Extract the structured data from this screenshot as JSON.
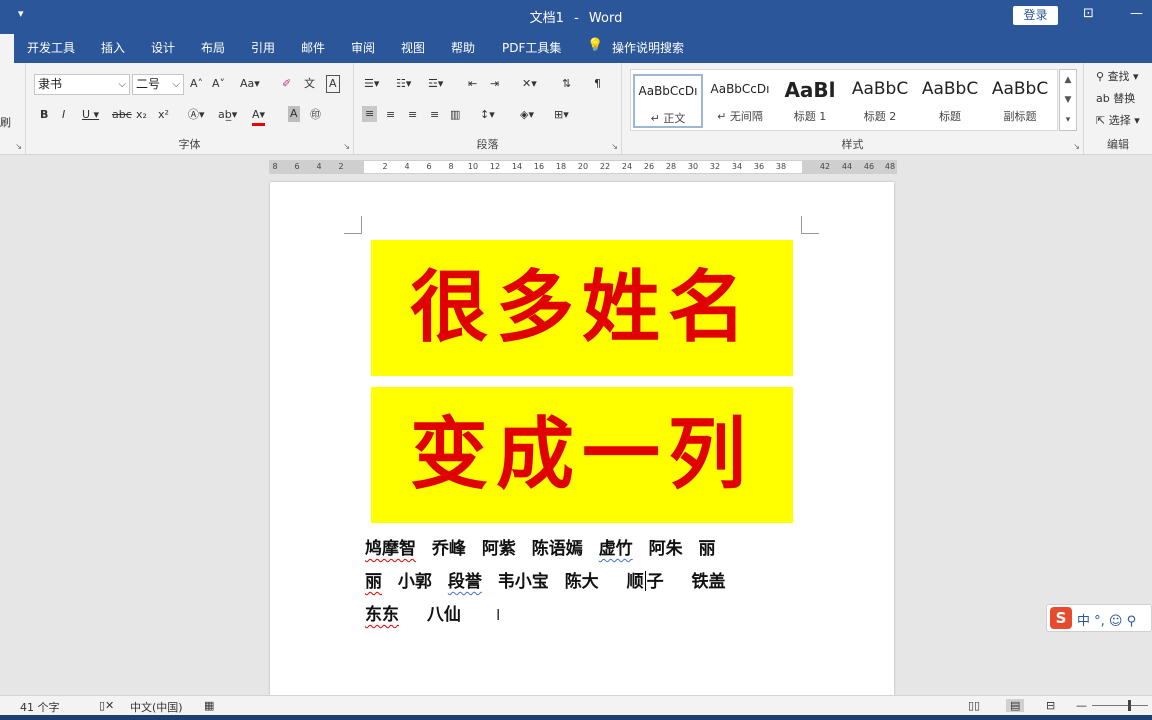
{
  "titlebar": {
    "doc_name": "文档1",
    "separator": "-",
    "app_name": "Word",
    "login_label": "登录"
  },
  "tabs": [
    "开发工具",
    "插入",
    "设计",
    "布局",
    "引用",
    "邮件",
    "审阅",
    "视图",
    "帮助",
    "PDF工具集"
  ],
  "tell_me": "操作说明搜索",
  "font": {
    "name": "隶书",
    "size": "二号",
    "group_label": "字体",
    "left_edge_label": "刷"
  },
  "paragraph": {
    "group_label": "段落"
  },
  "styles": {
    "group_label": "样式",
    "items": [
      {
        "preview": "AaBbCcDı",
        "name": "↵ 正文"
      },
      {
        "preview": "AaBbCcDı",
        "name": "↵ 无间隔"
      },
      {
        "preview": "AaBl",
        "name": "标题 1"
      },
      {
        "preview": "AaBbC",
        "name": "标题 2"
      },
      {
        "preview": "AaBbC",
        "name": "标题"
      },
      {
        "preview": "AaBbC",
        "name": "副标题"
      }
    ]
  },
  "editing": {
    "group_label": "编辑",
    "find": "查找",
    "replace": "替换",
    "select": "选择"
  },
  "ruler_numbers": [
    "8",
    "6",
    "4",
    "2",
    "2",
    "4",
    "6",
    "8",
    "10",
    "12",
    "14",
    "16",
    "18",
    "20",
    "22",
    "24",
    "26",
    "28",
    "30",
    "32",
    "34",
    "36",
    "38",
    "42",
    "44",
    "46",
    "48"
  ],
  "document": {
    "banner_1": "很多姓名",
    "banner_2": "变成一列",
    "line_1": [
      "鸠摩智",
      "乔峰",
      "阿紫",
      "陈语嫣",
      "虚竹",
      "阿朱",
      "丽"
    ],
    "line_2_first": "丽",
    "line_2": [
      "小郭",
      "段誉",
      "韦小宝",
      "陈大",
      "顺",
      "子",
      "铁盖"
    ],
    "line_3": [
      "东东",
      "八仙"
    ]
  },
  "ime": {
    "logo": "S",
    "text": "中 °, ☺ ⚲"
  },
  "status": {
    "word_count": "41 个字",
    "language": "中文(中国)"
  }
}
